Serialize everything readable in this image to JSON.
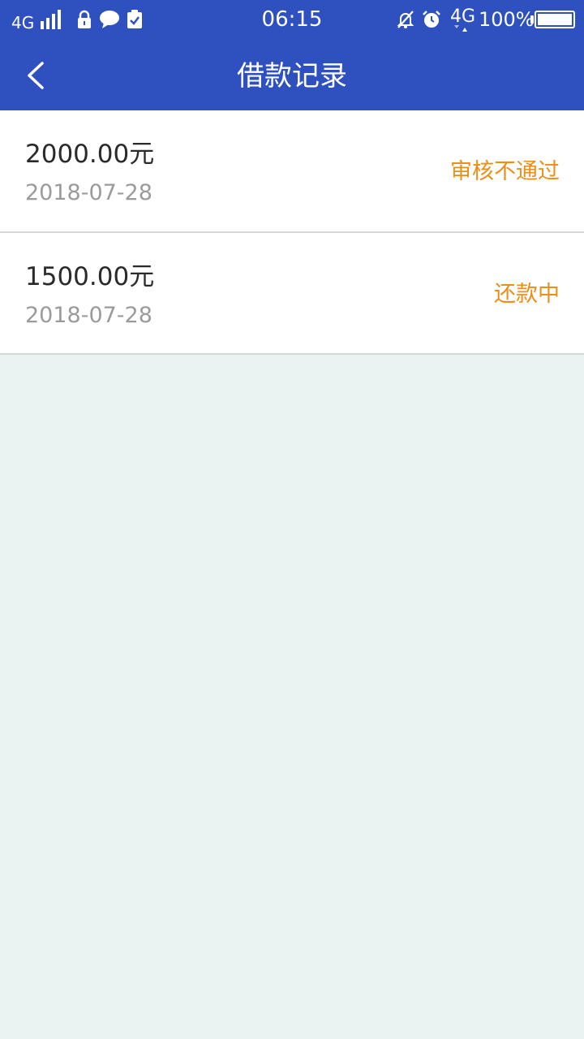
{
  "status_bar": {
    "network_left": "4G",
    "time": "06:15",
    "network_right": "4G",
    "battery_percent": "100%"
  },
  "header": {
    "title": "借款记录"
  },
  "records": [
    {
      "amount": "2000.00元",
      "date": "2018-07-28",
      "status": "审核不通过"
    },
    {
      "amount": "1500.00元",
      "date": "2018-07-28",
      "status": "还款中"
    }
  ],
  "colors": {
    "header_bg": "#2f51c0",
    "status_text": "#ec8e17",
    "page_bg": "#ebf2f2"
  }
}
